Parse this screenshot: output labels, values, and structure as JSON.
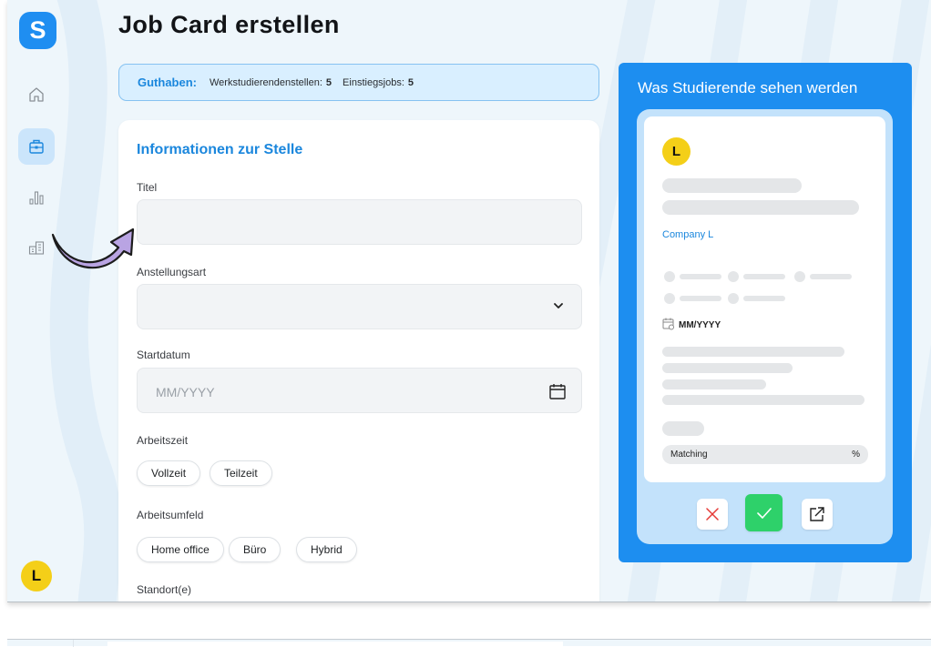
{
  "app": {
    "logo_letter": "S",
    "user_initial": "L"
  },
  "sidebar": {
    "items": [
      {
        "name": "home",
        "icon": "home-icon"
      },
      {
        "name": "jobs",
        "icon": "briefcase-icon",
        "active": true
      },
      {
        "name": "analytics",
        "icon": "bar-chart-icon"
      },
      {
        "name": "company",
        "icon": "buildings-icon"
      }
    ]
  },
  "page": {
    "title": "Job Card erstellen"
  },
  "credit": {
    "label": "Guthaben:",
    "item1_label": "Werkstudierendenstellen:",
    "item1_value": "5",
    "item2_label": "Einstiegsjobs:",
    "item2_value": "5"
  },
  "form": {
    "section_title": "Informationen zur Stelle",
    "title_label": "Titel",
    "title_value": "",
    "employment_label": "Anstellungsart",
    "employment_value": "",
    "start_label": "Startdatum",
    "start_placeholder": "MM/YYYY",
    "worktime_label": "Arbeitszeit",
    "worktime_options": [
      "Vollzeit",
      "Teilzeit"
    ],
    "workplace_label": "Arbeitsumfeld",
    "workplace_options": [
      "Home office",
      "Büro",
      "Hybrid"
    ],
    "location_label": "Standort(e)"
  },
  "preview": {
    "title": "Was Studierende sehen werden",
    "avatar_initial": "L",
    "company": "Company L",
    "date": "MM/YYYY",
    "matching_label": "Matching",
    "matching_unit": "%"
  },
  "colors": {
    "accent": "#1d8ef0",
    "accept": "#2ed16a",
    "reject": "#e53935",
    "avatar": "#f4cf18",
    "pointer_arrow": "#b9a4e3"
  }
}
